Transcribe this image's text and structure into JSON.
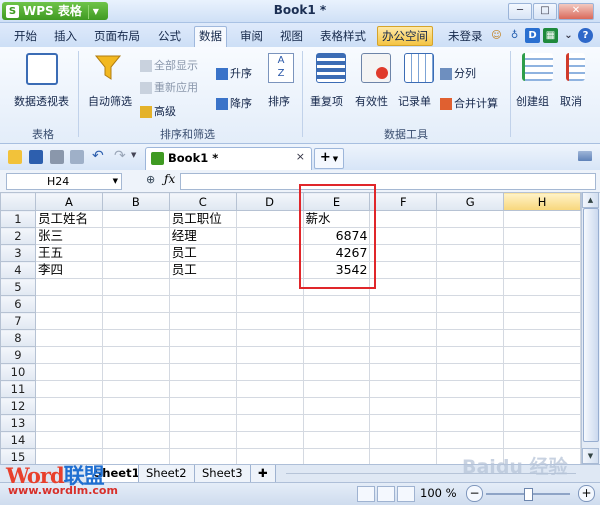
{
  "app": {
    "name": "WPS 表格",
    "doc_title": "Book1 *"
  },
  "menu": {
    "tabs": [
      "开始",
      "插入",
      "页面布局",
      "公式",
      "数据",
      "审阅",
      "视图",
      "表格样式",
      "办公空间"
    ],
    "active_tab": "数据",
    "login": "未登录"
  },
  "ribbon": {
    "pivot": "数据透视表",
    "autofilter": "自动筛选",
    "show_all": "全部显示",
    "reapply": "重新应用",
    "advanced": "高级",
    "sort_asc": "升序",
    "sort_desc": "降序",
    "sort": "排序",
    "duplicates": "重复项",
    "validity": "有效性",
    "records": "记录单",
    "split": "分列",
    "consolidate": "合并计算",
    "create_group": "创建组",
    "cancel": "取消",
    "group_table": "表格",
    "group_sort_filter": "排序和筛选",
    "group_data_tools": "数据工具"
  },
  "doc_tab": {
    "name": "Book1 *",
    "close": "×",
    "new": "+"
  },
  "formula_bar": {
    "cell_ref": "H24",
    "formula": ""
  },
  "sheet": {
    "columns": [
      "A",
      "B",
      "C",
      "D",
      "E",
      "F",
      "G",
      "H"
    ],
    "selected_column": "H",
    "rows": [
      {
        "n": "1",
        "A": "员工姓名",
        "B": "",
        "C": "员工职位",
        "D": "",
        "E": "薪水",
        "F": "",
        "G": "",
        "H": ""
      },
      {
        "n": "2",
        "A": "张三",
        "B": "",
        "C": "经理",
        "D": "",
        "E": "6874",
        "F": "",
        "G": "",
        "H": ""
      },
      {
        "n": "3",
        "A": "王五",
        "B": "",
        "C": "员工",
        "D": "",
        "E": "4267",
        "F": "",
        "G": "",
        "H": ""
      },
      {
        "n": "4",
        "A": "李四",
        "B": "",
        "C": "员工",
        "D": "",
        "E": "3542",
        "F": "",
        "G": "",
        "H": ""
      },
      {
        "n": "5"
      },
      {
        "n": "6"
      },
      {
        "n": "7"
      },
      {
        "n": "8"
      },
      {
        "n": "9"
      },
      {
        "n": "10"
      },
      {
        "n": "11"
      },
      {
        "n": "12"
      },
      {
        "n": "13"
      },
      {
        "n": "14"
      },
      {
        "n": "15"
      }
    ]
  },
  "sheet_tabs": [
    "Sheet1",
    "Sheet2",
    "Sheet3"
  ],
  "active_sheet": "Sheet1",
  "status": {
    "zoom": "100 %"
  },
  "watermark": {
    "logo": "Word联盟",
    "url": "www.wordlm.com",
    "baidu": "Baidu 经验"
  },
  "colors": {
    "accent": "#3f9a22",
    "highlight_box": "#e0262a",
    "selected_header": "#f7d67a"
  }
}
